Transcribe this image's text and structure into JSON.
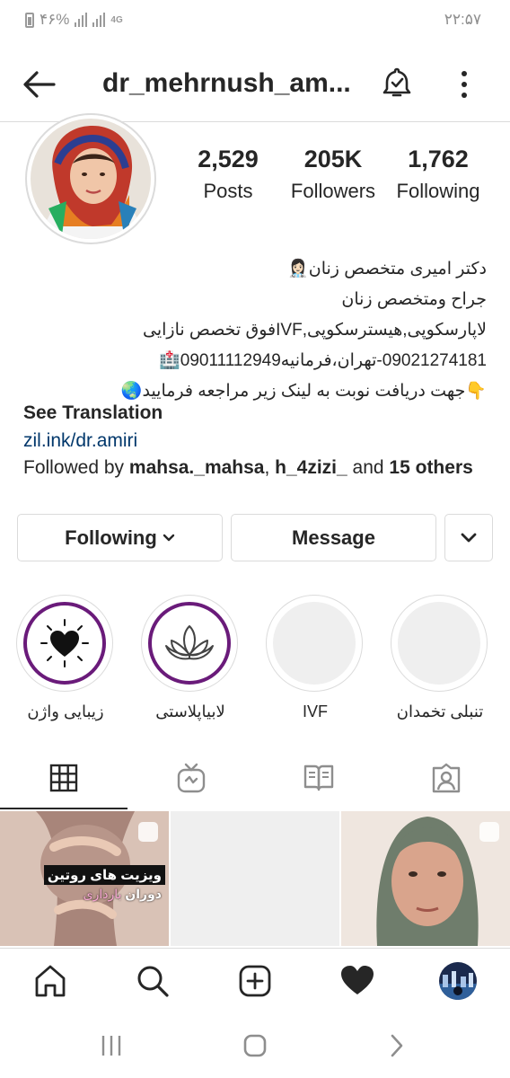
{
  "status_bar": {
    "battery": "۴۶%",
    "network": "4G",
    "time": "۲۲:۵۷"
  },
  "header": {
    "username": "dr_mehrnush_am...",
    "back_icon": "arrow-left-icon",
    "bell_icon": "bell-check-icon",
    "more_icon": "more-vertical-icon"
  },
  "profile": {
    "stats": [
      {
        "value": "2,529",
        "label": "Posts"
      },
      {
        "value": "205K",
        "label": "Followers"
      },
      {
        "value": "1,762",
        "label": "Following"
      }
    ],
    "bio_lines": [
      "دکتر امیری متخصص زنان👩🏻‍⚕️",
      "جراح ومتخصص زنان",
      "لاپارسکوپی,هیسترسکوپی,IVFفوق تخصص نازایی",
      "09021274181-تهران،فرمانیه09011112949🏥",
      "👇جهت دریافت نوبت به لینک زیر مراجعه فرمایید🌏"
    ],
    "see_translation": "See Translation",
    "link": "zil.ink/dr.amiri",
    "followed_by_prefix": "Followed by ",
    "followed_by_user1": "mahsa._mahsa",
    "followed_by_sep": ", ",
    "followed_by_user2": "h_4zizi_",
    "followed_by_and": " and ",
    "followed_by_others": "15 others"
  },
  "actions": {
    "following_label": "Following",
    "message_label": "Message"
  },
  "highlights": [
    {
      "label": "زیبایی واژن",
      "icon": "heart-sun-icon"
    },
    {
      "label": "لابیاپلاستی",
      "icon": "lotus-icon"
    },
    {
      "label": "IVF",
      "icon": ""
    },
    {
      "label": "تنبلی تخمدان",
      "icon": ""
    }
  ],
  "tabs": [
    "grid-icon",
    "igtv-icon",
    "guide-icon",
    "tagged-icon"
  ],
  "posts": {
    "post1_title": "ویزیت های روتین",
    "post1_sub_a": "دوران ",
    "post1_sub_b": "بارداری"
  },
  "bottom_nav": [
    "home-icon",
    "search-icon",
    "add-icon",
    "heart-icon",
    "profile-avatar"
  ],
  "colors": {
    "highlight_ring": "#6a1b7a",
    "link": "#00376b",
    "text": "#262626",
    "divider": "#dbdbdb"
  }
}
